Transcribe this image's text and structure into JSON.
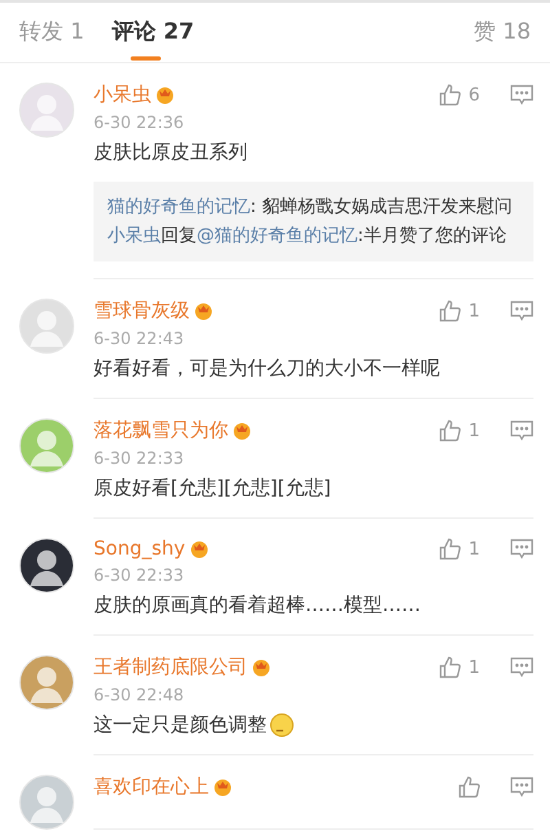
{
  "tabs": [
    {
      "label": "转发 1",
      "selected": false
    },
    {
      "label": "评论 27",
      "selected": true
    }
  ],
  "likes_tab": {
    "label": "赞 18"
  },
  "comments": [
    {
      "name": "小呆虫",
      "time": "6-30 22:36",
      "text": "皮肤比原皮丑系列",
      "likes": "6",
      "replies": [
        {
          "author": "猫的好奇鱼的记忆",
          "text": ": 貂蝉杨戬女娲成吉思汗发来慰问"
        },
        {
          "author": "小呆虫",
          "verb": "回复",
          "target": "@猫的好奇鱼的记忆",
          "text": ":半月赞了您的评论"
        }
      ]
    },
    {
      "name": "雪球骨灰级",
      "time": "6-30 22:43",
      "text": "好看好看，可是为什么刀的大小不一样呢",
      "likes": "1"
    },
    {
      "name": "落花飘雪只为你",
      "time": "6-30 22:33",
      "text": "原皮好看[允悲][允悲][允悲]",
      "likes": "1"
    },
    {
      "name": "Song_shy",
      "time": "6-30 22:33",
      "text": "皮肤的原画真的看着超棒……模型……",
      "likes": "1"
    },
    {
      "name": "王者制药底限公司",
      "time": "6-30 22:48",
      "text": "这一定只是颜色调整",
      "likes": "1",
      "emoji": true
    },
    {
      "name": "喜欢印在心上"
    }
  ]
}
